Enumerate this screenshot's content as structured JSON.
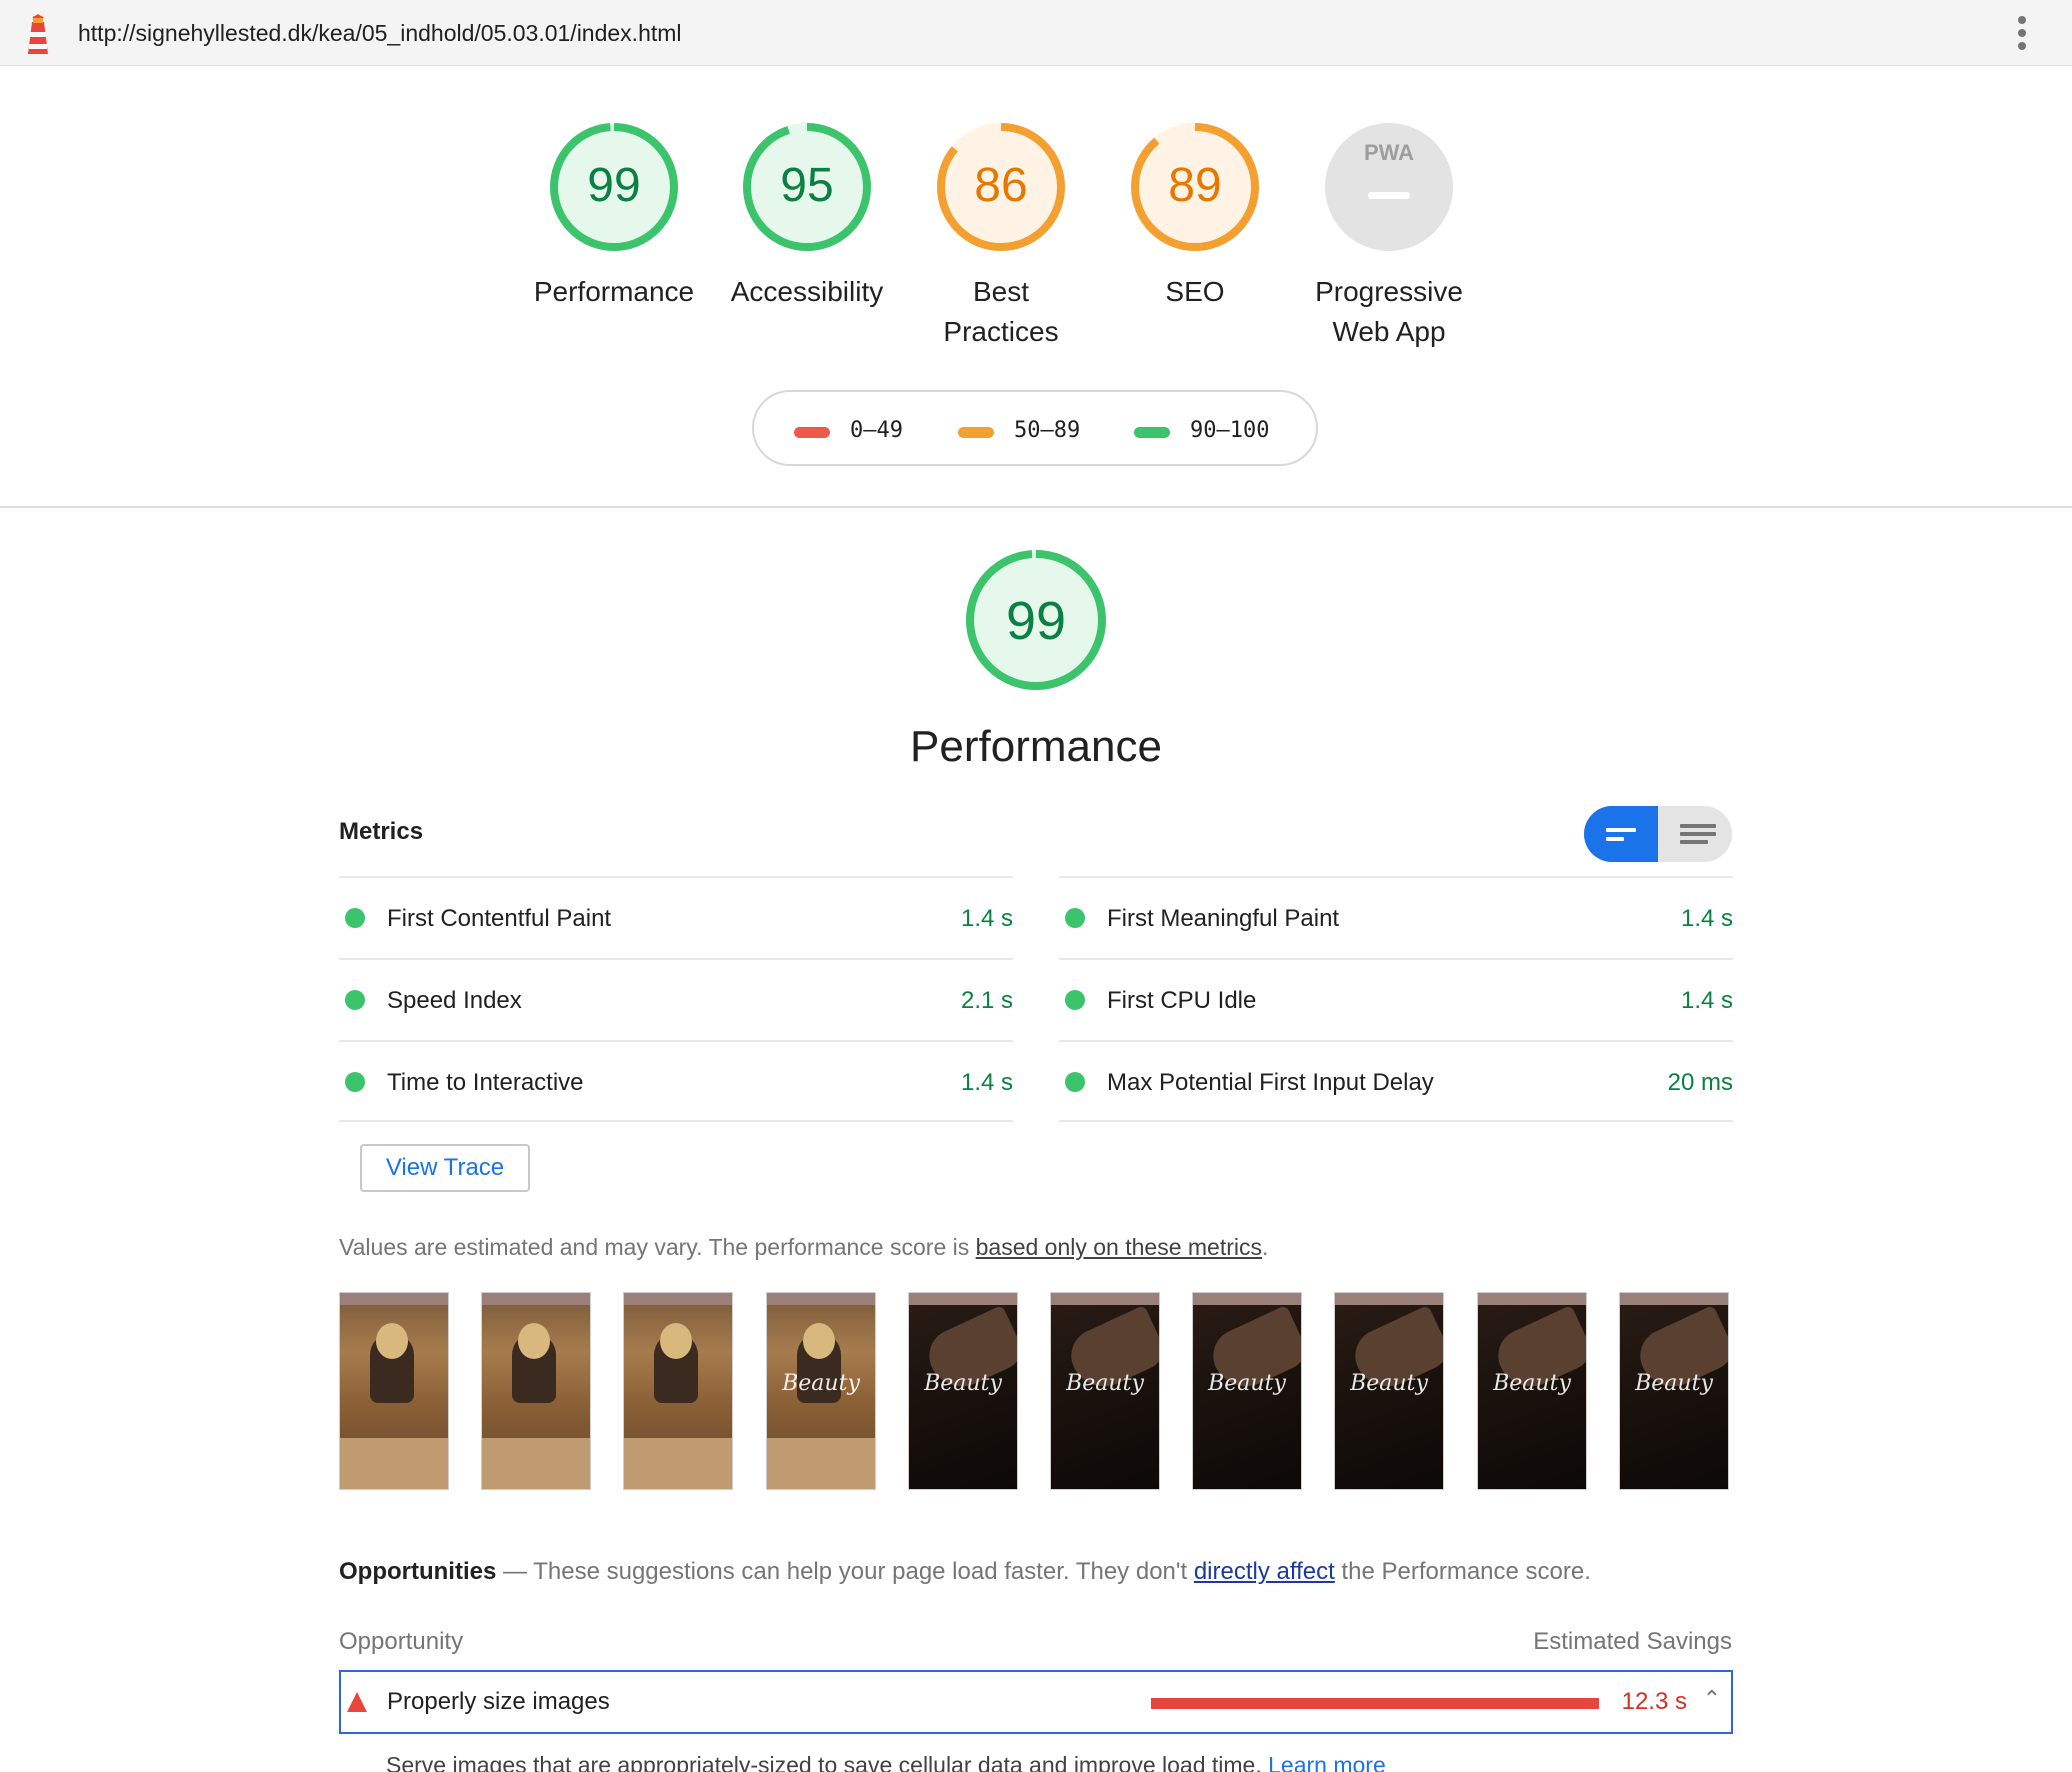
{
  "toolbar": {
    "url": "http://signehyllested.dk/kea/05_indhold/05.03.01/index.html",
    "logo_icon": "lighthouse-icon",
    "menu_icon": "more-vert-icon"
  },
  "gauges": [
    {
      "score": "99",
      "label_line1": "Performance",
      "label_line2": "",
      "status": "pass",
      "fraction": 0.99
    },
    {
      "score": "95",
      "label_line1": "Accessibility",
      "label_line2": "",
      "status": "pass",
      "fraction": 0.95
    },
    {
      "score": "86",
      "label_line1": "Best",
      "label_line2": "Practices",
      "status": "average",
      "fraction": 0.86
    },
    {
      "score": "89",
      "label_line1": "SEO",
      "label_line2": "",
      "status": "average",
      "fraction": 0.89
    },
    {
      "score": "PWA",
      "label_line1": "Progressive",
      "label_line2": "Web App",
      "status": "na",
      "fraction": 0
    }
  ],
  "legend": [
    {
      "range": "0–49",
      "color": "#eb5a4b"
    },
    {
      "range": "50–89",
      "color": "#f4a030"
    },
    {
      "range": "90–100",
      "color": "#3cc46c"
    }
  ],
  "performance": {
    "score": "99",
    "score_fraction": 0.99,
    "title": "Performance",
    "metrics_heading": "Metrics",
    "metrics_left": [
      {
        "label": "First Contentful Paint",
        "value": "1.4 s"
      },
      {
        "label": "Speed Index",
        "value": "2.1 s"
      },
      {
        "label": "Time to Interactive",
        "value": "1.4 s"
      }
    ],
    "metrics_right": [
      {
        "label": "First Meaningful Paint",
        "value": "1.4 s"
      },
      {
        "label": "First CPU Idle",
        "value": "1.4 s"
      },
      {
        "label": "Max Potential First Input Delay",
        "value": "20 ms"
      }
    ],
    "view_trace_label": "View Trace",
    "note_prefix": "Values are estimated and may vary. The performance score is ",
    "note_link": "based only on these metrics",
    "note_suffix": ".",
    "filmstrip_text": "Beauty"
  },
  "opportunities": {
    "heading": "Opportunities",
    "dash": " — ",
    "desc_prefix": "These suggestions can help your page load faster. They don't ",
    "desc_link": "directly affect",
    "desc_suffix": " the Performance score.",
    "col_left": "Opportunity",
    "col_right": "Estimated Savings",
    "items": [
      {
        "title": "Properly size images",
        "savings": "12.3 s",
        "savings_fraction": 1.0,
        "description": "Serve images that are appropriately-sized to save cellular data and improve load time. ",
        "link": "Learn more"
      }
    ]
  },
  "colors": {
    "pass": "#3cc46c",
    "pass_text": "#0b8043",
    "average": "#f4a030",
    "average_text": "#e67700",
    "fail": "#eb5a4b",
    "accent": "#1a73e8"
  }
}
